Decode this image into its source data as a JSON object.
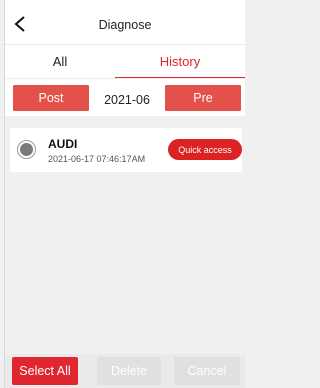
{
  "header": {
    "title": "Diagnose",
    "back_icon": "chevron-left-icon"
  },
  "tabs": [
    {
      "label": "All",
      "active": false
    },
    {
      "label": "History",
      "active": true
    }
  ],
  "date_nav": {
    "prev_label": "Post",
    "current": "2021-06",
    "next_label": "Pre"
  },
  "records": [
    {
      "name": "AUDI",
      "timestamp": "2021-06-17 07:46:17AM",
      "action_label": "Quick access",
      "selected": true
    }
  ],
  "footer": {
    "select_all": "Select All",
    "delete": "Delete",
    "cancel": "Cancel"
  },
  "colors": {
    "accent": "#e0262f",
    "button_red": "#e4514a",
    "disabled": "#e0e0e0"
  }
}
